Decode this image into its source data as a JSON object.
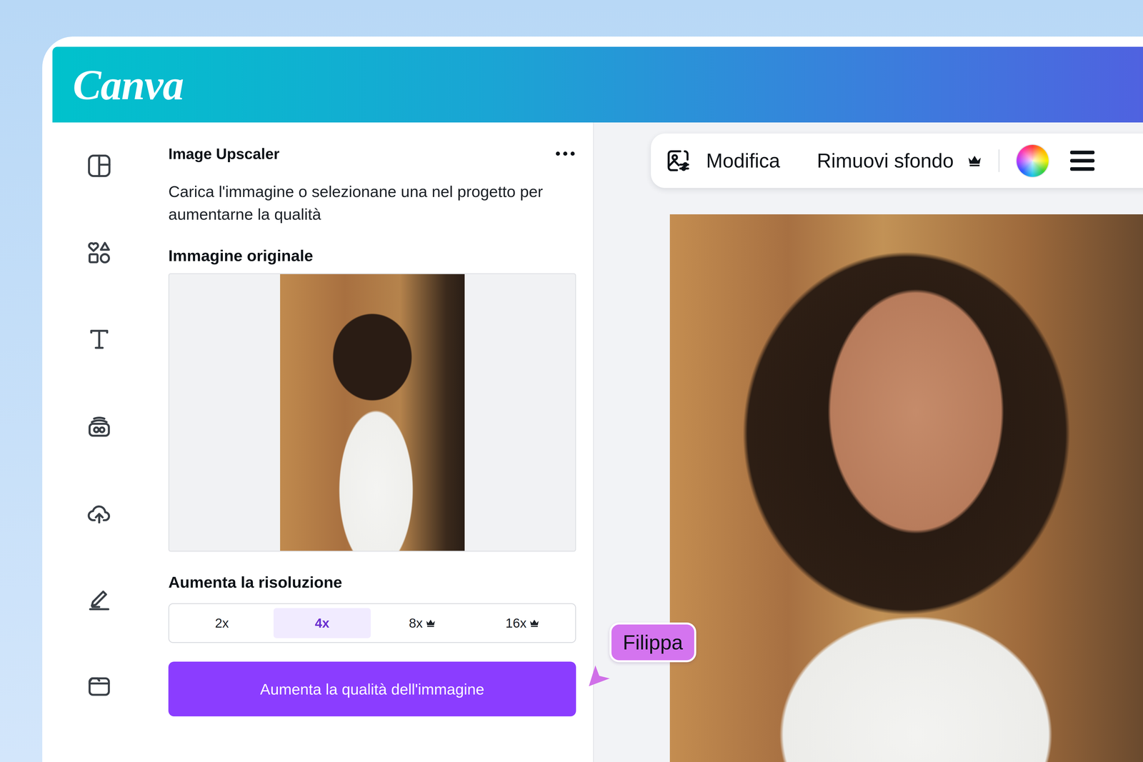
{
  "app": {
    "logo": "Canva"
  },
  "panel": {
    "title": "Image Upscaler",
    "description": "Carica l'immagine o selezionane una nel progetto per aumentarne la qualità",
    "original_label": "Immagine originale",
    "resolution_label": "Aumenta la risoluzione",
    "scales": [
      {
        "label": "2x",
        "selected": false,
        "premium": false
      },
      {
        "label": "4x",
        "selected": true,
        "premium": false
      },
      {
        "label": "8x",
        "selected": false,
        "premium": true
      },
      {
        "label": "16x",
        "selected": false,
        "premium": true
      }
    ],
    "button": "Aumenta la qualità dell'immagine"
  },
  "toolbar": {
    "items": [
      {
        "label": "Modifica",
        "premium": false
      },
      {
        "label": "Rimuovi sfondo",
        "premium": true
      }
    ]
  },
  "collaborator": {
    "name": "Filippa"
  }
}
